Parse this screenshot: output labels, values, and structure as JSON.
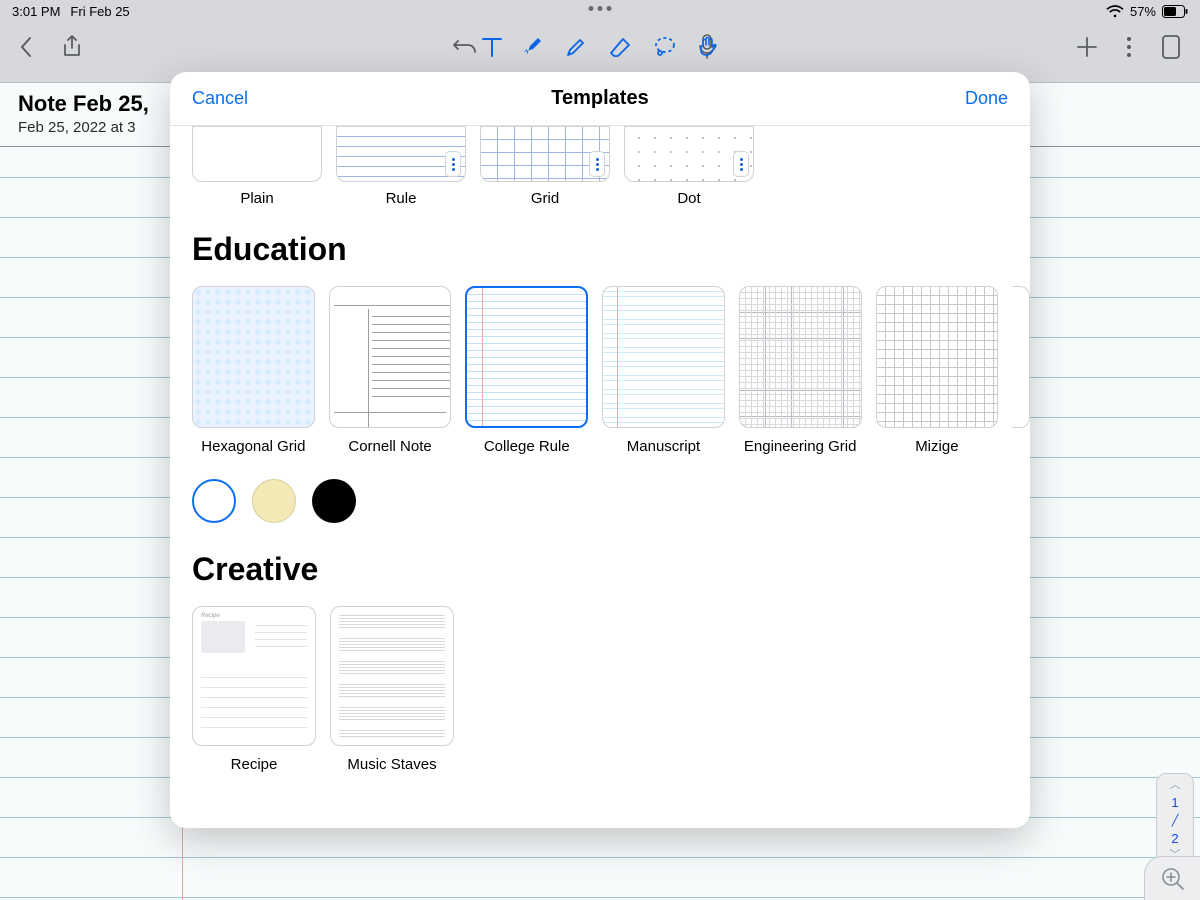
{
  "status": {
    "time": "3:01 PM",
    "date": "Fri Feb 25",
    "battery_pct": "57%"
  },
  "note": {
    "title": "Note Feb 25,",
    "subtitle": "Feb 25, 2022 at 3"
  },
  "pager": {
    "current": "1",
    "total": "2"
  },
  "modal": {
    "cancel": "Cancel",
    "done": "Done",
    "title": "Templates",
    "top": [
      {
        "label": "Plain"
      },
      {
        "label": "Rule"
      },
      {
        "label": "Grid"
      },
      {
        "label": "Dot"
      }
    ],
    "education_heading": "Education",
    "education": [
      {
        "label": "Hexagonal Grid"
      },
      {
        "label": "Cornell Note"
      },
      {
        "label": "College Rule"
      },
      {
        "label": "Manuscript"
      },
      {
        "label": "Engineering Grid"
      },
      {
        "label": "Mizige"
      }
    ],
    "selected_template": "College Rule",
    "colors": [
      "white",
      "cream",
      "black"
    ],
    "selected_color": "white",
    "creative_heading": "Creative",
    "creative": [
      {
        "label": "Recipe"
      },
      {
        "label": "Music Staves"
      }
    ]
  }
}
